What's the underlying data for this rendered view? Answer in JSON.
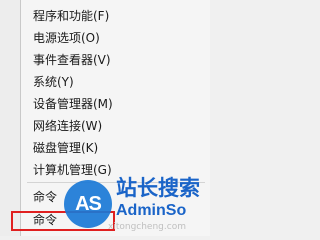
{
  "menu": {
    "items": [
      {
        "label": "程序和功能(F)"
      },
      {
        "label": "电源选项(O)"
      },
      {
        "label": "事件查看器(V)"
      },
      {
        "label": "系统(Y)"
      },
      {
        "label": "设备管理器(M)"
      },
      {
        "label": "网络连接(W)"
      },
      {
        "label": "磁盘管理(K)"
      },
      {
        "label": "计算机管理(G)"
      },
      {
        "label": "命令"
      },
      {
        "label": "命令"
      }
    ]
  },
  "watermark": {
    "logo_text": "AS",
    "cn_text": "站长搜索",
    "en_text": "AdminSo",
    "url_text": "xitongcheng.com"
  },
  "colors": {
    "highlight_border": "#e02020",
    "watermark_blue": "#1a64c8"
  }
}
